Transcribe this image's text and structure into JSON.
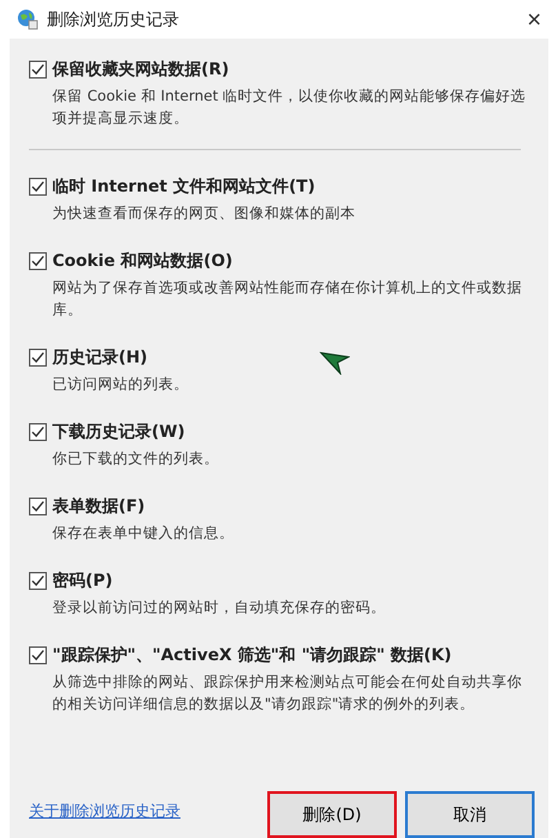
{
  "window": {
    "title": "删除浏览历史记录",
    "close": "×"
  },
  "options": [
    {
      "kind": "option",
      "label": "保留收藏夹网站数据(R)",
      "description": "保留 Cookie 和 Internet 临时文件，以使你收藏的网站能够保存偏好选项并提高显示速度。",
      "checked": true
    },
    {
      "kind": "divider"
    },
    {
      "kind": "option",
      "label": "临时 Internet 文件和网站文件(T)",
      "description": "为快速查看而保存的网页、图像和媒体的副本",
      "checked": true
    },
    {
      "kind": "option",
      "label": "Cookie 和网站数据(O)",
      "description": "网站为了保存首选项或改善网站性能而存储在你计算机上的文件或数据库。",
      "checked": true
    },
    {
      "kind": "option",
      "label": "历史记录(H)",
      "description": "已访问网站的列表。",
      "checked": true
    },
    {
      "kind": "option",
      "label": "下载历史记录(W)",
      "description": "你已下载的文件的列表。",
      "checked": true
    },
    {
      "kind": "option",
      "label": "表单数据(F)",
      "description": "保存在表单中键入的信息。",
      "checked": true
    },
    {
      "kind": "option",
      "label": "密码(P)",
      "description": "登录以前访问过的网站时，自动填充保存的密码。",
      "checked": true
    },
    {
      "kind": "option",
      "label": "\"跟踪保护\"、\"ActiveX 筛选\"和 \"请勿跟踪\" 数据(K)",
      "description": "从筛选中排除的网站、跟踪保护用来检测站点可能会在何处自动共享你的相关访问详细信息的数据以及\"请勿跟踪\"请求的例外的列表。",
      "checked": true
    }
  ],
  "footer": {
    "link": "关于删除浏览历史记录",
    "buttons": [
      {
        "label": "删除(D)",
        "kind": "highlighted"
      },
      {
        "label": "取消",
        "kind": "default"
      }
    ]
  }
}
